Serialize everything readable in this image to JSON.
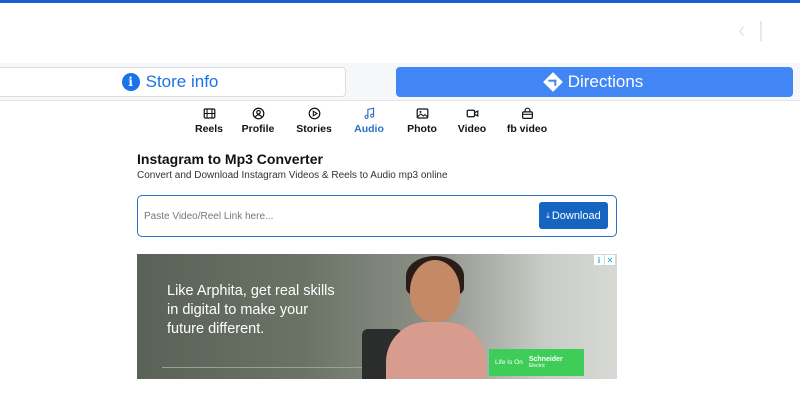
{
  "colors": {
    "accent": "#2d6ec5",
    "directions_button": "#4285f4",
    "download_button": "#1565c0",
    "brand_green": "#3dcd58"
  },
  "map_ad": {
    "store_info_label": "Store info",
    "directions_label": "Directions"
  },
  "tabs": [
    {
      "label": "Reels",
      "icon": "film-icon",
      "active": false
    },
    {
      "label": "Profile",
      "icon": "user-circle-icon",
      "active": false
    },
    {
      "label": "Stories",
      "icon": "play-circle-icon",
      "active": false
    },
    {
      "label": "Audio",
      "icon": "music-note-icon",
      "active": true
    },
    {
      "label": "Photo",
      "icon": "image-icon",
      "active": false
    },
    {
      "label": "Video",
      "icon": "video-camera-icon",
      "active": false
    },
    {
      "label": "fb video",
      "icon": "bag-icon",
      "active": false
    }
  ],
  "main": {
    "title": "Instagram to Mp3 Converter",
    "subtitle": "Convert and Download Instagram Videos & Reels to Audio mp3 online",
    "input_placeholder": "Paste Video/Reel Link here...",
    "input_value": "",
    "download_label": "Download"
  },
  "ad": {
    "headline": "Like Arphita, get real skills in digital to make your future different.",
    "tagline": "Life Is On",
    "brand_name": "Schneider",
    "brand_sub": "Electric"
  }
}
